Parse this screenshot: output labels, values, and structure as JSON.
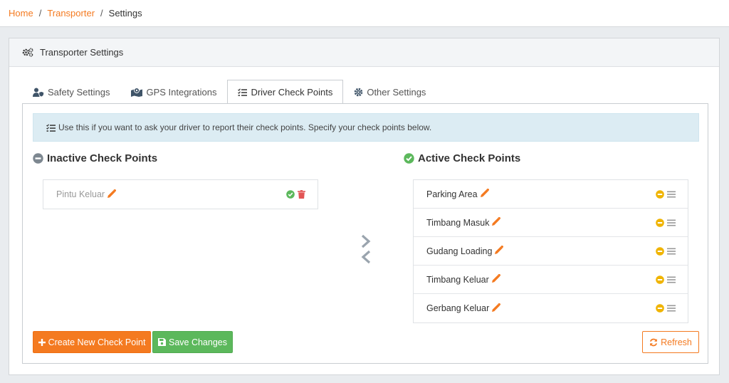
{
  "breadcrumb": {
    "home": "Home",
    "transporter": "Transporter",
    "current": "Settings",
    "separator": "/"
  },
  "card": {
    "title": "Transporter Settings"
  },
  "tabs": [
    {
      "label": "Safety Settings",
      "icon": "user-shield-icon"
    },
    {
      "label": "GPS Integrations",
      "icon": "map-marker-icon"
    },
    {
      "label": "Driver Check Points",
      "icon": "list-check-icon",
      "active": true
    },
    {
      "label": "Other Settings",
      "icon": "gear-icon"
    }
  ],
  "alert": {
    "text": "Use this if you want to ask your driver to report their check points. Specify your check points below."
  },
  "inactive": {
    "title": "Inactive Check Points",
    "items": [
      {
        "label": "Pintu Keluar"
      }
    ]
  },
  "active": {
    "title": "Active Check Points",
    "items": [
      {
        "label": "Parking Area"
      },
      {
        "label": "Timbang Masuk"
      },
      {
        "label": "Gudang Loading"
      },
      {
        "label": "Timbang Keluar"
      },
      {
        "label": "Gerbang Keluar"
      }
    ]
  },
  "buttons": {
    "create": "Create New Check Point",
    "save": "Save Changes",
    "refresh": "Refresh"
  },
  "colors": {
    "accent": "#f47a20",
    "success": "#5cb85c",
    "warning": "#f0b400",
    "danger": "#e25555",
    "info_bg": "#dcecf3"
  }
}
